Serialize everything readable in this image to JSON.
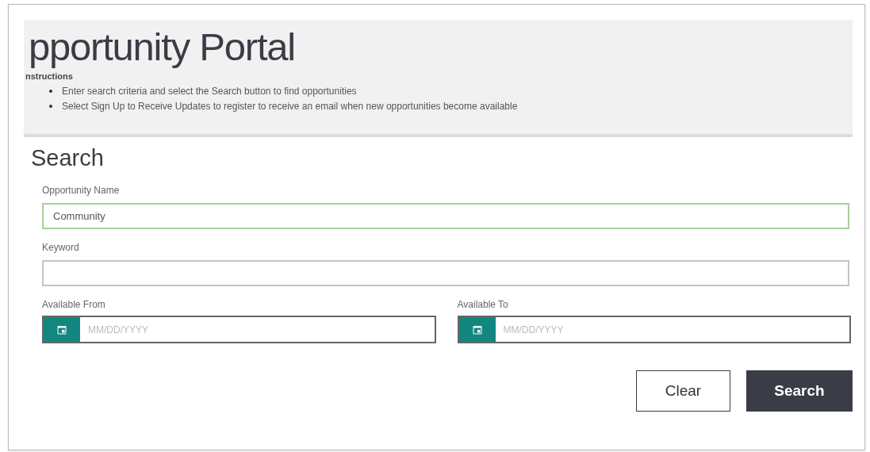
{
  "header": {
    "title": "pportunity Portal",
    "instructions_heading": "nstructions",
    "instructions": [
      "Enter search criteria and select the Search button to find opportunities",
      "Select Sign Up to Receive Updates to register to receive an email when new opportunities become available"
    ]
  },
  "search": {
    "heading": "Search",
    "fields": [
      {
        "kind": "text",
        "label": "Opportunity Name",
        "value": "Community",
        "focused": true
      },
      {
        "kind": "text",
        "label": "Keyword",
        "focused": false
      }
    ],
    "date_fields": [
      {
        "label": "Available From",
        "placeholder": "MM/DD/YYYY"
      },
      {
        "label": "Available To",
        "placeholder": "MM/DD/YYYY"
      }
    ],
    "buttons": [
      {
        "kind": "secondary",
        "label": "Clear"
      },
      {
        "kind": "primary",
        "label": "Search"
      }
    ]
  }
}
